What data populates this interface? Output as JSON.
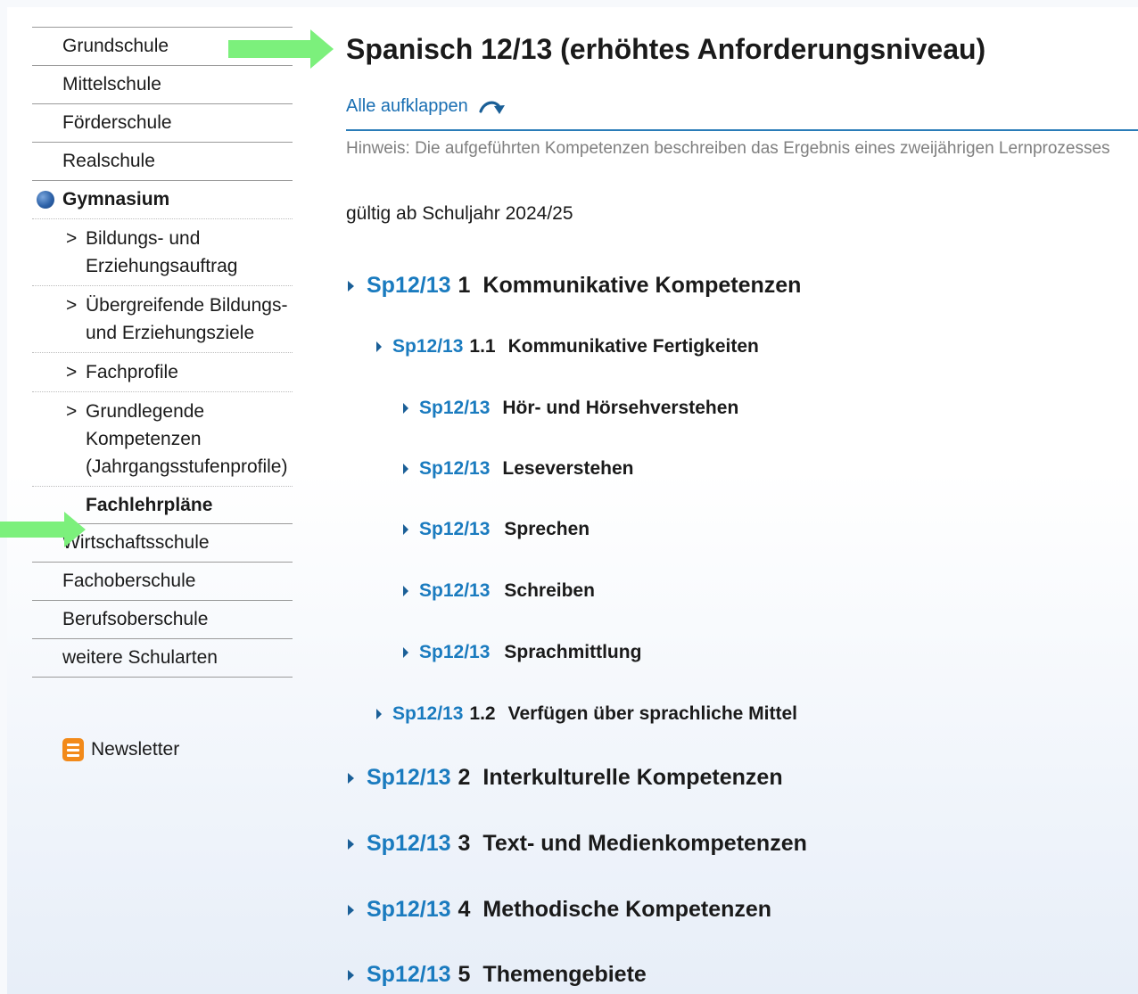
{
  "sidebar": {
    "items": [
      {
        "label": "Grundschule"
      },
      {
        "label": "Mittelschule"
      },
      {
        "label": "Förderschule"
      },
      {
        "label": "Realschule"
      },
      {
        "label": "Gymnasium"
      }
    ],
    "sub_items": [
      {
        "marker": ">",
        "label": "Bildungs- und Erziehungsauftrag"
      },
      {
        "marker": ">",
        "label": "Übergreifende Bildungs- und Erziehungsziele"
      },
      {
        "marker": ">",
        "label": "Fachprofile"
      },
      {
        "marker": ">",
        "label": "Grundlegende Kompetenzen (Jahrgangsstufenprofile)"
      },
      {
        "label": "Fachlehrpläne"
      }
    ],
    "items_after": [
      {
        "label": "Wirtschaftsschule"
      },
      {
        "label": "Fachoberschule"
      },
      {
        "label": "Berufsoberschule"
      },
      {
        "label": "weitere Schularten"
      }
    ],
    "newsletter": "Newsletter"
  },
  "main": {
    "title": "Spanisch 12/13 (erhöhtes Anforderungsniveau)",
    "expand_all": "Alle aufklappen",
    "hint": "Hinweis: Die aufgeführten Kompetenzen beschreiben das Ergebnis eines zweijährigen Lernprozesses",
    "valid_from": "gültig ab Schuljahr 2024/25",
    "tree": [
      {
        "code": "Sp12/13",
        "num": "1",
        "label": "Kommunikative Kompetenzen"
      },
      {
        "code": "Sp12/13",
        "num": "1.1",
        "label": "Kommunikative Fertigkeiten"
      },
      {
        "code": "Sp12/13",
        "num": "",
        "label": "Hör- und Hörsehverstehen"
      },
      {
        "code": "Sp12/13",
        "num": "",
        "label": "Leseverstehen"
      },
      {
        "code": "Sp12/13",
        "num": "",
        "label": "Sprechen"
      },
      {
        "code": "Sp12/13",
        "num": "",
        "label": "Schreiben"
      },
      {
        "code": "Sp12/13",
        "num": "",
        "label": "Sprachmittlung"
      },
      {
        "code": "Sp12/13",
        "num": "1.2",
        "label": "Verfügen über sprachliche Mittel"
      },
      {
        "code": "Sp12/13",
        "num": "2",
        "label": "Interkulturelle Kompetenzen"
      },
      {
        "code": "Sp12/13",
        "num": "3",
        "label": "Text- und Medienkompetenzen"
      },
      {
        "code": "Sp12/13",
        "num": "4",
        "label": "Methodische Kompetenzen"
      },
      {
        "code": "Sp12/13",
        "num": "5",
        "label": "Themengebiete"
      }
    ]
  },
  "colors": {
    "link": "#1a7bbf",
    "arrow": "#7cf07c",
    "rule": "#2a7cb8",
    "newsletter_icon": "#f28a1a",
    "active_dot": "#2d62a8"
  },
  "icons": [
    "chevron-right-arrow-icon",
    "expand-tree-icon",
    "newsletter-icon",
    "active-bullet-icon",
    "green-pointer-arrow-icon"
  ]
}
